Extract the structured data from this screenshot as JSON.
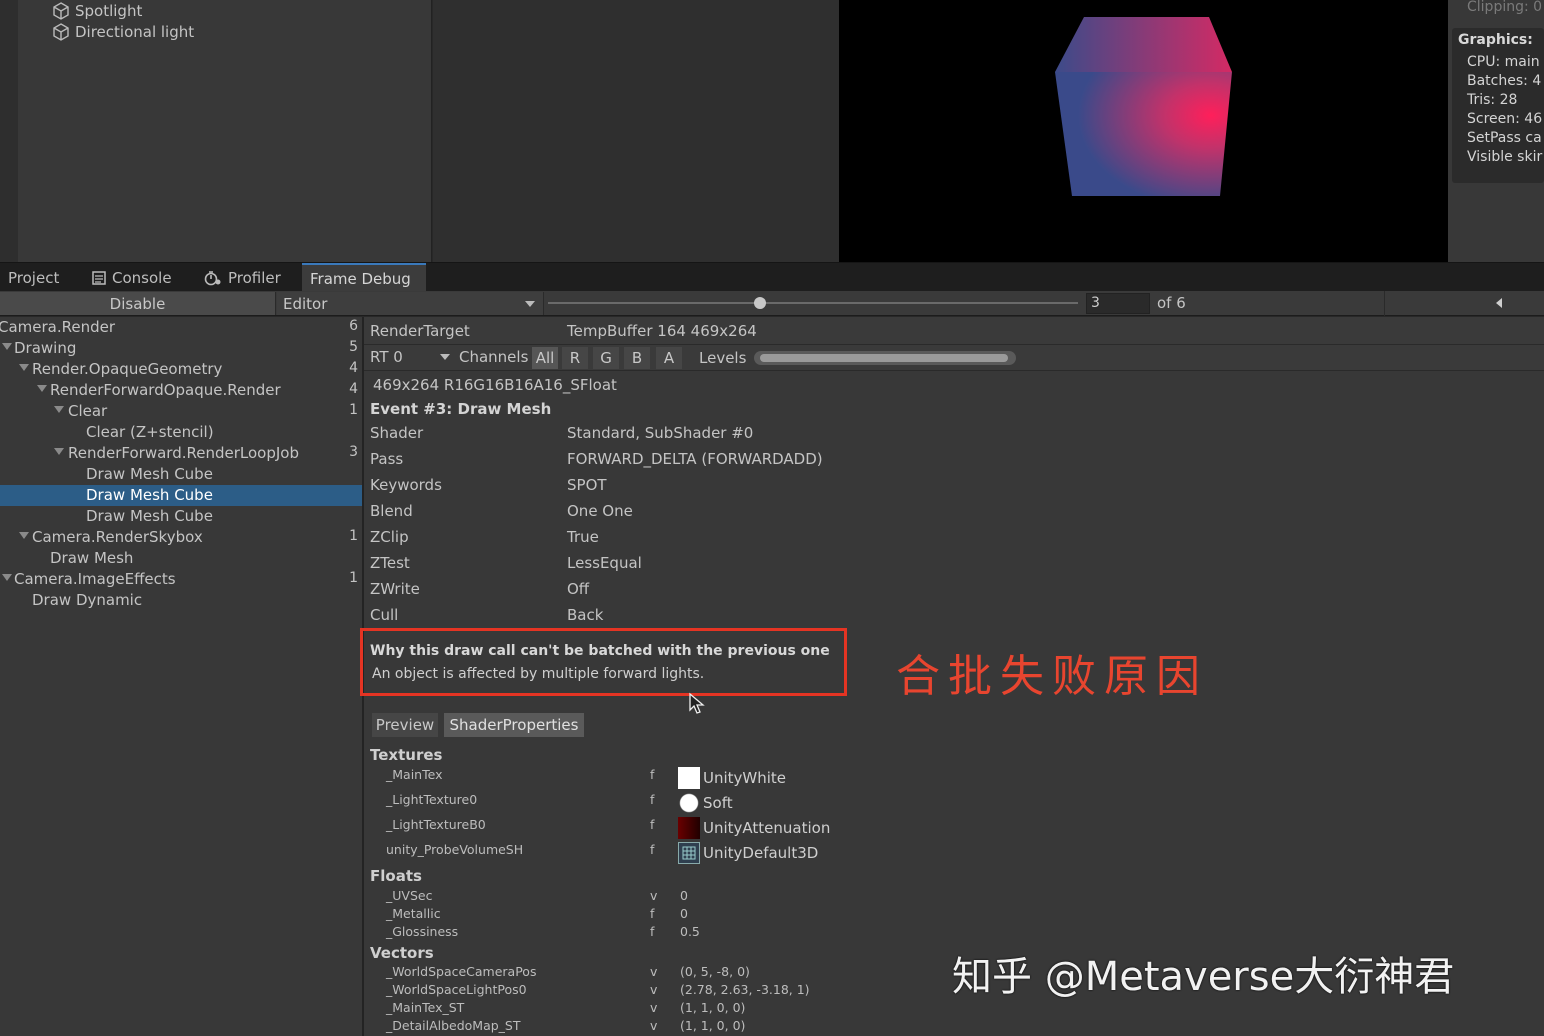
{
  "hierarchy": {
    "items": [
      "Spotlight",
      "Directional light"
    ]
  },
  "stats": {
    "clipping": "Clipping: 0",
    "graphics_label": "Graphics:",
    "lines": [
      "CPU: main",
      "Batches: 4",
      "Tris: 28",
      "Screen: 46",
      "SetPass ca",
      "Visible skir"
    ]
  },
  "tabs": [
    {
      "label": "Project",
      "icon": "folder-icon"
    },
    {
      "label": "Console",
      "icon": "console-icon"
    },
    {
      "label": "Profiler",
      "icon": "profiler-icon"
    },
    {
      "label": "Frame Debug",
      "icon": ""
    }
  ],
  "toolbar": {
    "disable_label": "Disable",
    "target_label": "Editor",
    "event_index": "3",
    "of_label": "of 6",
    "slider_fraction": 0.4
  },
  "tree": [
    {
      "label": "Camera.Render",
      "count": "6"
    },
    {
      "label": "Drawing",
      "count": "5"
    },
    {
      "label": "Render.OpaqueGeometry",
      "count": "4"
    },
    {
      "label": "RenderForwardOpaque.Render",
      "count": "4"
    },
    {
      "label": "Clear",
      "count": "1"
    },
    {
      "label": "Clear (Z+stencil)",
      "count": ""
    },
    {
      "label": "RenderForward.RenderLoopJob",
      "count": "3"
    },
    {
      "label": "Draw Mesh Cube",
      "count": ""
    },
    {
      "label": "Draw Mesh Cube",
      "count": ""
    },
    {
      "label": "Draw Mesh Cube",
      "count": ""
    },
    {
      "label": "Camera.RenderSkybox",
      "count": "1"
    },
    {
      "label": "Draw Mesh",
      "count": ""
    },
    {
      "label": "Camera.ImageEffects",
      "count": "1"
    },
    {
      "label": "Draw Dynamic",
      "count": ""
    }
  ],
  "details": {
    "render_target_label": "RenderTarget",
    "render_target_value": "TempBuffer 164 469x264",
    "rt_label": "RT 0",
    "channels_label": "Channels",
    "channels": [
      "All",
      "R",
      "G",
      "B",
      "A"
    ],
    "levels_label": "Levels",
    "format": "469x264 R16G16B16A16_SFloat",
    "event_title": "Event #3: Draw Mesh",
    "props": [
      {
        "k": "Shader",
        "v": "Standard, SubShader #0"
      },
      {
        "k": "Pass",
        "v": "FORWARD_DELTA (FORWARDADD)"
      },
      {
        "k": "Keywords",
        "v": "SPOT"
      },
      {
        "k": "Blend",
        "v": "One One"
      },
      {
        "k": "ZClip",
        "v": "True"
      },
      {
        "k": "ZTest",
        "v": "LessEqual"
      },
      {
        "k": "ZWrite",
        "v": "Off"
      },
      {
        "k": "Cull",
        "v": "Back"
      }
    ],
    "batch_title": "Why this draw call can't be batched with the previous one",
    "batch_reason": "An object is affected by multiple forward lights.",
    "subtabs": [
      "Preview",
      "ShaderProperties"
    ],
    "textures_label": "Textures",
    "textures": [
      {
        "k": "_MainTex",
        "t": "f",
        "v": "UnityWhite"
      },
      {
        "k": "_LightTexture0",
        "t": "f",
        "v": "Soft"
      },
      {
        "k": "_LightTextureB0",
        "t": "f",
        "v": "UnityAttenuation"
      },
      {
        "k": "unity_ProbeVolumeSH",
        "t": "f",
        "v": "UnityDefault3D"
      }
    ],
    "floats_label": "Floats",
    "floats": [
      {
        "k": "_UVSec",
        "t": "v",
        "v": "0"
      },
      {
        "k": "_Metallic",
        "t": "f",
        "v": "0"
      },
      {
        "k": "_Glossiness",
        "t": "f",
        "v": "0.5"
      }
    ],
    "vectors_label": "Vectors",
    "vectors": [
      {
        "k": "_WorldSpaceCameraPos",
        "t": "v",
        "v": "(0, 5, -8, 0)"
      },
      {
        "k": "_WorldSpaceLightPos0",
        "t": "v",
        "v": "(2.78, 2.63, -3.18, 1)"
      },
      {
        "k": "_MainTex_ST",
        "t": "v",
        "v": "(1, 1, 0, 0)"
      },
      {
        "k": "_DetailAlbedoMap_ST",
        "t": "v",
        "v": "(1, 1, 0, 0)"
      }
    ]
  },
  "annotation": "合批失败原因",
  "watermark": "知乎 @Metaverse大衍神君",
  "colors": {
    "accent": "#3a79bb",
    "selection": "#2c5d87",
    "annotation_red": "#e53423"
  }
}
